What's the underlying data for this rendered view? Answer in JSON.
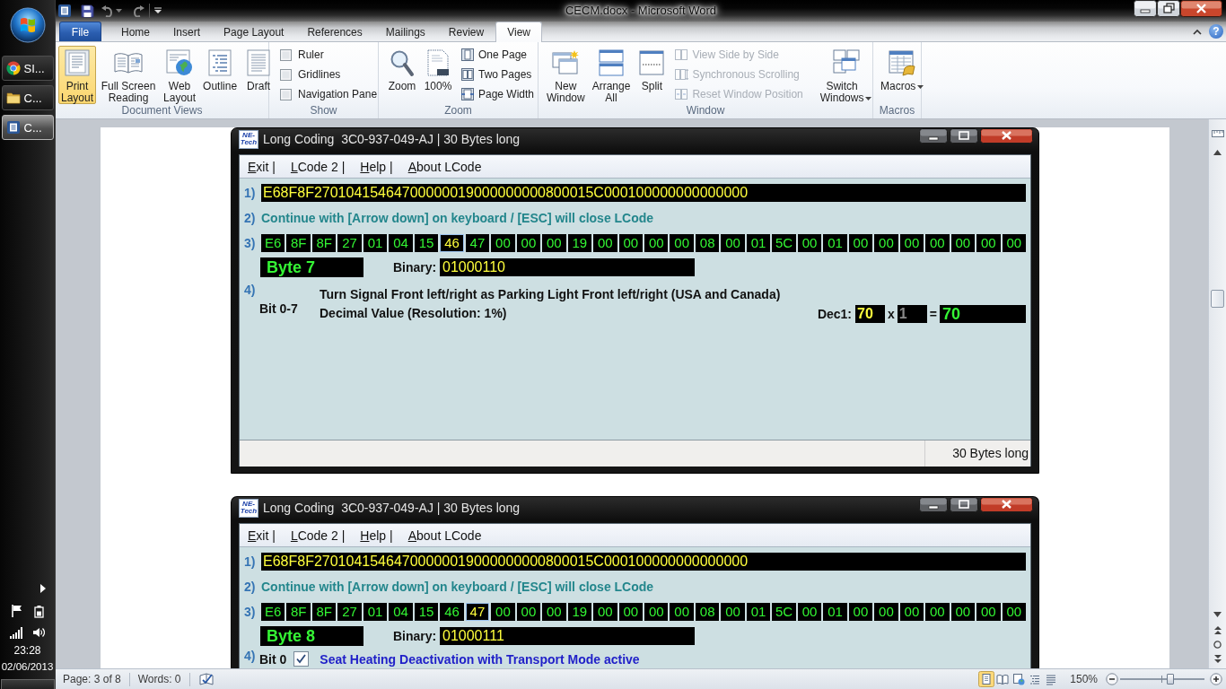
{
  "taskbar": {
    "items": [
      {
        "kind": "browser",
        "label": "SI...",
        "selected": false
      },
      {
        "kind": "folder",
        "label": "C...",
        "selected": false
      },
      {
        "kind": "word",
        "label": "C...",
        "selected": true
      }
    ],
    "clock": {
      "time": "23:28",
      "date": "02/06/2013"
    }
  },
  "window": {
    "title": "CECM.docx - Microsoft Word",
    "help": "?"
  },
  "tabs": [
    {
      "kind": "file",
      "label": "File",
      "selected": false
    },
    {
      "kind": "tab",
      "label": "Home",
      "selected": false
    },
    {
      "kind": "tab",
      "label": "Insert",
      "selected": false
    },
    {
      "kind": "tab",
      "label": "Page Layout",
      "selected": false
    },
    {
      "kind": "tab",
      "label": "References",
      "selected": false
    },
    {
      "kind": "tab",
      "label": "Mailings",
      "selected": false
    },
    {
      "kind": "tab",
      "label": "Review",
      "selected": false
    },
    {
      "kind": "tab",
      "label": "View",
      "selected": true
    }
  ],
  "ribbon": {
    "groups": [
      {
        "title": "Document Views",
        "controls": [
          {
            "kind": "large",
            "label": "Print Layout",
            "selected": true
          },
          {
            "kind": "large",
            "label": "Full Screen Reading",
            "selected": false
          },
          {
            "kind": "large",
            "label": "Web Layout",
            "selected": false
          },
          {
            "kind": "large",
            "label": "Outline",
            "selected": false
          },
          {
            "kind": "large",
            "label": "Draft",
            "selected": false
          }
        ]
      },
      {
        "title": "Show",
        "controls": [
          {
            "kind": "check",
            "label": "Ruler",
            "checked": false
          },
          {
            "kind": "check",
            "label": "Gridlines",
            "checked": false
          },
          {
            "kind": "check",
            "label": "Navigation Pane",
            "checked": false
          }
        ]
      },
      {
        "title": "Zoom",
        "controls": [
          {
            "kind": "large",
            "label": "Zoom"
          },
          {
            "kind": "large",
            "label": "100%"
          },
          {
            "kind": "small",
            "label": "One Page"
          },
          {
            "kind": "small",
            "label": "Two Pages"
          },
          {
            "kind": "small",
            "label": "Page Width"
          }
        ]
      },
      {
        "title": "Window",
        "controls": [
          {
            "kind": "large",
            "label": "New Window",
            "disabled": false
          },
          {
            "kind": "large",
            "label": "Arrange All",
            "disabled": false
          },
          {
            "kind": "large",
            "label": "Split",
            "disabled": false
          },
          {
            "kind": "small",
            "label": "View Side by Side",
            "disabled": true
          },
          {
            "kind": "small",
            "label": "Synchronous Scrolling",
            "disabled": true
          },
          {
            "kind": "small",
            "label": "Reset Window Position",
            "disabled": true
          },
          {
            "kind": "menu",
            "label": "Switch Windows",
            "disabled": false
          }
        ]
      },
      {
        "title": "Macros",
        "controls": [
          {
            "kind": "menu",
            "label": "Macros"
          }
        ]
      }
    ]
  },
  "document": {
    "screenshots": [
      {
        "kind": "decimal",
        "logo": "NE-Tech",
        "title": "Long Coding  3C0-937-049-AJ | 30 Bytes long",
        "menu": [
          "Exit |",
          "LCode 2 |",
          "Help |",
          "About LCode"
        ],
        "code_label": "1)",
        "code": "E68F8F27010415464700000019000000000800015C000100000000000000",
        "hint_label": "2)",
        "hint": "Continue with [Arrow down] on keyboard / [ESC] will close LCode",
        "bytes_label": "3)",
        "bytes": [
          {
            "value": "E6",
            "selected": false
          },
          {
            "value": "8F",
            "selected": false
          },
          {
            "value": "8F",
            "selected": false
          },
          {
            "value": "27",
            "selected": false
          },
          {
            "value": "01",
            "selected": false
          },
          {
            "value": "04",
            "selected": false
          },
          {
            "value": "15",
            "selected": false
          },
          {
            "value": "46",
            "selected": true
          },
          {
            "value": "47",
            "selected": false
          },
          {
            "value": "00",
            "selected": false
          },
          {
            "value": "00",
            "selected": false
          },
          {
            "value": "00",
            "selected": false
          },
          {
            "value": "19",
            "selected": false
          },
          {
            "value": "00",
            "selected": false
          },
          {
            "value": "00",
            "selected": false
          },
          {
            "value": "00",
            "selected": false
          },
          {
            "value": "00",
            "selected": false
          },
          {
            "value": "08",
            "selected": false
          },
          {
            "value": "00",
            "selected": false
          },
          {
            "value": "01",
            "selected": false
          },
          {
            "value": "5C",
            "selected": false
          },
          {
            "value": "00",
            "selected": false
          },
          {
            "value": "01",
            "selected": false
          },
          {
            "value": "00",
            "selected": false
          },
          {
            "value": "00",
            "selected": false
          },
          {
            "value": "00",
            "selected": false
          },
          {
            "value": "00",
            "selected": false
          },
          {
            "value": "00",
            "selected": false
          },
          {
            "value": "00",
            "selected": false
          },
          {
            "value": "00",
            "selected": false
          }
        ],
        "byte_name": "Byte 7",
        "binary_label": "Binary:",
        "binary": "01000110",
        "detail_label": "4)",
        "bit": "Bit 0-7",
        "lines": [
          "Turn Signal Front left/right as Parking Light Front left/right (USA and Canada)",
          "Decimal Value (Resolution: 1%)"
        ],
        "dec_label": "Dec1:",
        "dec_value": "70",
        "times": "x",
        "factor": {
          "value": "1",
          "disabled": true
        },
        "equals": "=",
        "result": "70",
        "status": "30 Bytes long"
      },
      {
        "kind": "flag",
        "logo": "NE-Tech",
        "title": "Long Coding  3C0-937-049-AJ | 30 Bytes long",
        "menu": [
          "Exit |",
          "LCode 2 |",
          "Help |",
          "About LCode"
        ],
        "code_label": "1)",
        "code": "E68F8F27010415464700000019000000000800015C000100000000000000",
        "hint_label": "2)",
        "hint": "Continue with [Arrow down] on keyboard / [ESC] will close LCode",
        "bytes_label": "3)",
        "bytes": [
          {
            "value": "E6",
            "selected": false
          },
          {
            "value": "8F",
            "selected": false
          },
          {
            "value": "8F",
            "selected": false
          },
          {
            "value": "27",
            "selected": false
          },
          {
            "value": "01",
            "selected": false
          },
          {
            "value": "04",
            "selected": false
          },
          {
            "value": "15",
            "selected": false
          },
          {
            "value": "46",
            "selected": false
          },
          {
            "value": "47",
            "selected": true
          },
          {
            "value": "00",
            "selected": false
          },
          {
            "value": "00",
            "selected": false
          },
          {
            "value": "00",
            "selected": false
          },
          {
            "value": "19",
            "selected": false
          },
          {
            "value": "00",
            "selected": false
          },
          {
            "value": "00",
            "selected": false
          },
          {
            "value": "00",
            "selected": false
          },
          {
            "value": "00",
            "selected": false
          },
          {
            "value": "08",
            "selected": false
          },
          {
            "value": "00",
            "selected": false
          },
          {
            "value": "01",
            "selected": false
          },
          {
            "value": "5C",
            "selected": false
          },
          {
            "value": "00",
            "selected": false
          },
          {
            "value": "01",
            "selected": false
          },
          {
            "value": "00",
            "selected": false
          },
          {
            "value": "00",
            "selected": false
          },
          {
            "value": "00",
            "selected": false
          },
          {
            "value": "00",
            "selected": false
          },
          {
            "value": "00",
            "selected": false
          },
          {
            "value": "00",
            "selected": false
          },
          {
            "value": "00",
            "selected": false
          }
        ],
        "byte_name": "Byte 8",
        "binary_label": "Binary:",
        "binary": "01000111",
        "detail_label": "4)",
        "bit": "Bit 0",
        "flag": {
          "checked": true,
          "label": "Seat Heating Deactivation with Transport Mode active"
        }
      }
    ]
  },
  "status_bar": {
    "page": "Page: 3 of 8",
    "words": "Words: 0",
    "views": [
      {
        "selected": true
      },
      {
        "selected": false
      },
      {
        "selected": false
      },
      {
        "selected": false
      },
      {
        "selected": false
      }
    ],
    "zoom": "150%",
    "zoom_slider": {
      "level": 0.6
    }
  }
}
